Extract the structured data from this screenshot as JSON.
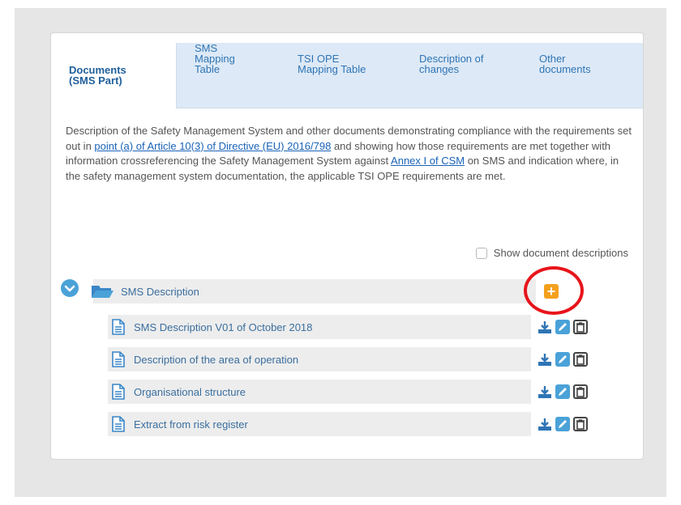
{
  "tabs": [
    {
      "label": "Documents\n(SMS Part)",
      "active": true
    },
    {
      "label": "SMS\nMapping\nTable",
      "active": false
    },
    {
      "label": "TSI OPE\nMapping Table",
      "active": false
    },
    {
      "label": "Description of\nchanges",
      "active": false
    },
    {
      "label": "Other\ndocuments",
      "active": false
    }
  ],
  "description": {
    "part1": "Description of the Safety Management System and other documents demonstrating compliance with the requirements set out in ",
    "link1": "point (a) of Article 10(3) of Directive (EU) 2016/798",
    "part2": " and showing how those requirements are met together with information crossreferencing the Safety Management System against ",
    "link2": "Annex I of CSM",
    "part3": " on SMS and indication where, in the safety management system documentation, the applicable TSI OPE requirements are met."
  },
  "show_descriptions_label": "Show document descriptions",
  "folder": {
    "label": "SMS Description"
  },
  "documents": [
    {
      "label": "SMS Description V01 of October 2018"
    },
    {
      "label": "Description of the area of operation"
    },
    {
      "label": "Organisational structure"
    },
    {
      "label": "Extract from risk register"
    }
  ],
  "colors": {
    "accent": "#4aa2d8",
    "add_button": "#f4a01d",
    "highlight_ring": "#e8141b",
    "tab_bar": "#dde9f6",
    "link": "#1a63b8"
  },
  "icons": {
    "expand": "chevron-down-icon",
    "folder": "folder-open-icon",
    "document": "document-icon",
    "add": "plus-icon",
    "download": "download-icon",
    "edit": "pencil-icon",
    "delete": "trash-icon"
  }
}
